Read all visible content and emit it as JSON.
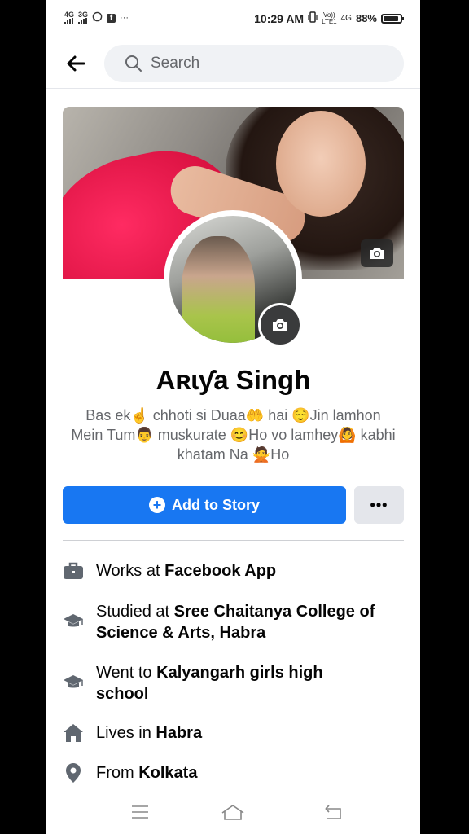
{
  "status_bar": {
    "sim1": "4G",
    "sim2": "3G",
    "more": "···",
    "time": "10:29 AM",
    "volte_top": "Vo))",
    "volte_bottom": "LTE1",
    "net": "4G",
    "battery": "88%",
    "battery_level": 0.88
  },
  "header": {
    "search_placeholder": "Search"
  },
  "profile": {
    "name": "Aʀɩƴa Singh",
    "bio": "Bas ek☝ chhoti si Duaa🤲 hai 😌Jin lamhon Mein Tum👨 muskurate 😊Ho vo lamhey🙆 kabhi khatam Na 🙅Ho"
  },
  "actions": {
    "add_story_label": "Add to Story",
    "more_label": "•••"
  },
  "info": [
    {
      "icon": "briefcase-icon",
      "prefix": "Works at ",
      "value": "Facebook App"
    },
    {
      "icon": "graduation-cap-icon",
      "prefix": "Studied at ",
      "value": "Sree Chaitanya College of Science & Arts, Habra"
    },
    {
      "icon": "graduation-cap-icon",
      "prefix": "Went to ",
      "value": "Kalyangarh girls high school"
    },
    {
      "icon": "home-icon",
      "prefix": "Lives in ",
      "value": "Habra"
    },
    {
      "icon": "location-pin-icon",
      "prefix": "From ",
      "value": "Kolkata"
    }
  ],
  "colors": {
    "accent": "#1877f2",
    "secondary_button": "#e4e6eb",
    "muted_text": "#65676b",
    "icon_gray": "#606770"
  }
}
